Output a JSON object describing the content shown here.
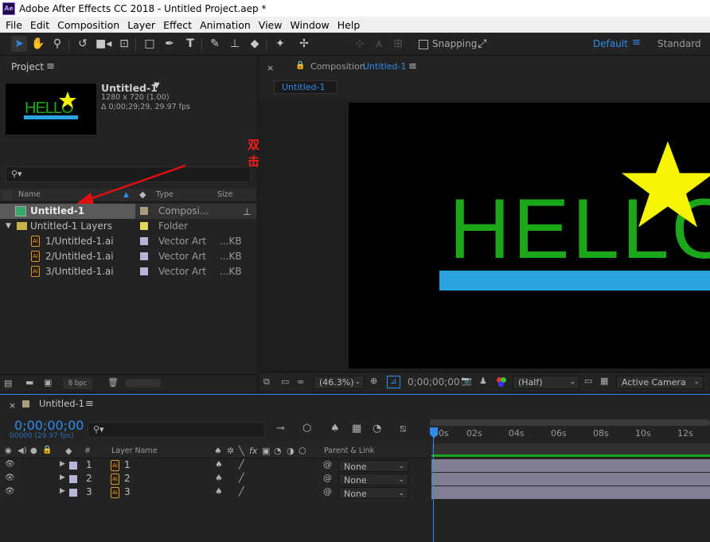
{
  "window": {
    "title": "Adobe After Effects CC 2018 - Untitled Project.aep *",
    "app_badge": "Ae"
  },
  "menu": [
    "File",
    "Edit",
    "Composition",
    "Layer",
    "Effect",
    "Animation",
    "View",
    "Window",
    "Help"
  ],
  "toolbar": {
    "snapping_label": "Snapping",
    "workspace_default": "Default",
    "workspace_standard": "Standard"
  },
  "project": {
    "panel_title": "Project",
    "comp_name": "Untitled-1",
    "comp_dims": "1280 x 720 (1.00)",
    "comp_duration": "Δ 0;00;29;29, 29.97 fps",
    "thumbnail_text": "HELLO",
    "annotation": "双击",
    "columns": {
      "name": "Name",
      "type": "Type",
      "size": "Size"
    },
    "items": [
      {
        "name": "Untitled-1",
        "type": "Composi...",
        "size": "",
        "color": "#a89c7d",
        "kind": "comp"
      },
      {
        "name": "Untitled-1 Layers",
        "type": "Folder",
        "size": "",
        "color": "#e2d55c",
        "kind": "folder"
      },
      {
        "name": "1/Untitled-1.ai",
        "type": "Vector Art",
        "size": "...KB",
        "color": "#b7b4d9",
        "kind": "ai"
      },
      {
        "name": "2/Untitled-1.ai",
        "type": "Vector Art",
        "size": "...KB",
        "color": "#b7b4d9",
        "kind": "ai"
      },
      {
        "name": "3/Untitled-1.ai",
        "type": "Vector Art",
        "size": "...KB",
        "color": "#b7b4d9",
        "kind": "ai"
      }
    ],
    "bpc": "8 bpc"
  },
  "composition": {
    "panel_label": "Composition",
    "panel_comp_name": "Untitled-1",
    "tab": "Untitled-1",
    "canvas_text": "HELLO",
    "zoom": "(46.3%)",
    "timecode": "0;00;00;00",
    "resolution": "(Half)",
    "camera": "Active Camera"
  },
  "timeline": {
    "tab": "Untitled-1",
    "timecode": "0;00;00;00",
    "frame_info": "00000 (29.97 fps)",
    "layer_name_header": "Layer Name",
    "parent_header": "Parent & Link",
    "num_header": "#",
    "ruler": [
      "00s",
      "02s",
      "04s",
      "06s",
      "08s",
      "10s",
      "12s"
    ],
    "layers": [
      {
        "num": "1",
        "name": "1",
        "parent": "None"
      },
      {
        "num": "2",
        "name": "2",
        "parent": "None"
      },
      {
        "num": "3",
        "name": "3",
        "parent": "None"
      }
    ]
  },
  "colors": {
    "accent": "#2d8ceb",
    "hello_green": "#1aa81a",
    "star_yellow": "#f6f400",
    "bar_blue": "#2aa3de"
  }
}
